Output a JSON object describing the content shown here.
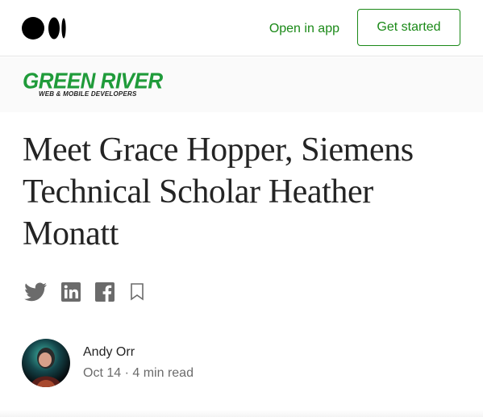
{
  "header": {
    "logo_icon": "medium-logo-icon",
    "open_in_app": "Open in app",
    "get_started": "Get started",
    "accent_color": "#1a8917"
  },
  "publication": {
    "name": "GREEN RIVER",
    "tagline": "WEB & MOBILE DEVELOPERS",
    "brand_color": "#1f9b3a"
  },
  "article": {
    "title": "Meet Grace Hopper, Siemens Technical Scholar Heather Monatt"
  },
  "share": {
    "icons": [
      "twitter-icon",
      "linkedin-icon",
      "facebook-icon",
      "bookmark-icon"
    ]
  },
  "author": {
    "name": "Andy Orr",
    "date": "Oct 14",
    "separator": "·",
    "read_time": "4 min read"
  }
}
